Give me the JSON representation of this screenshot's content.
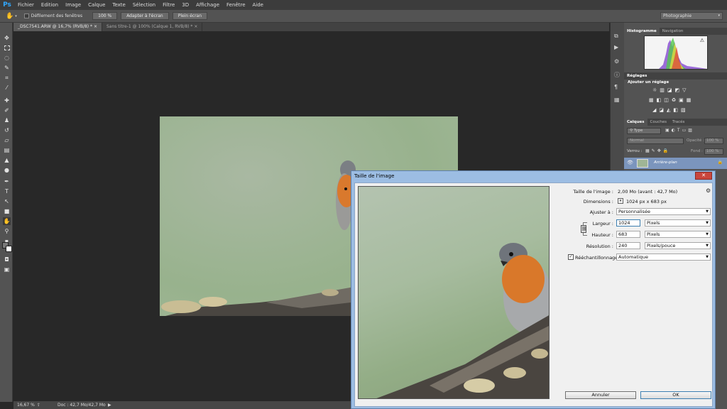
{
  "menu": {
    "logo": "Ps",
    "items": [
      "Fichier",
      "Edition",
      "Image",
      "Calque",
      "Texte",
      "Sélection",
      "Filtre",
      "3D",
      "Affichage",
      "Fenêtre",
      "Aide"
    ]
  },
  "options": {
    "scroll_all_label": "Défilement des fenêtres",
    "zoom_100": "100 %",
    "fit_screen": "Adapter à l'écran",
    "full_screen": "Plein écran",
    "workspace": "Photographie"
  },
  "tabs": [
    {
      "label": "_DSC7541.ARW @ 16,7% (RVB/8) *"
    },
    {
      "label": "Sans titre-1 @ 100% (Calque 1, RVB/8) *"
    }
  ],
  "status": {
    "zoom": "16,67 %",
    "doc": "Doc : 42,7 Mo/42,7 Mo"
  },
  "panels": {
    "histogram_tab": "Histogramme",
    "navigation_tab": "Navigation",
    "adjustments_title": "Réglages",
    "add_adjustment": "Ajouter un réglage",
    "layers_tab": "Calques",
    "channels_tab": "Couches",
    "paths_tab": "Tracés",
    "type_filter": "Type",
    "blend_mode": "Normal",
    "opacity_label": "Opacité :",
    "opacity_value": "100 %",
    "lock_label": "Verrou :",
    "fill_label": "Fond :",
    "fill_value": "100 %",
    "layer_name": "Arrière-plan"
  },
  "dialog": {
    "title": "Taille de l'image",
    "image_size_label": "Taille de l'image :",
    "image_size_value": "2,00 Mo (avant : 42,7 Mo)",
    "dimensions_label": "Dimensions :",
    "dimensions_value": "1024 px x 683 px",
    "fit_label": "Ajuster à :",
    "fit_value": "Personnalisée",
    "width_label": "Largeur :",
    "width_value": "1024",
    "width_unit": "Pixels",
    "height_label": "Hauteur :",
    "height_value": "683",
    "height_unit": "Pixels",
    "resolution_label": "Résolution :",
    "resolution_value": "240",
    "resolution_unit": "Pixels/pouce",
    "resample_label": "Rééchantillonnage :",
    "resample_value": "Automatique",
    "cancel": "Annuler",
    "ok": "OK",
    "close": "✕"
  }
}
